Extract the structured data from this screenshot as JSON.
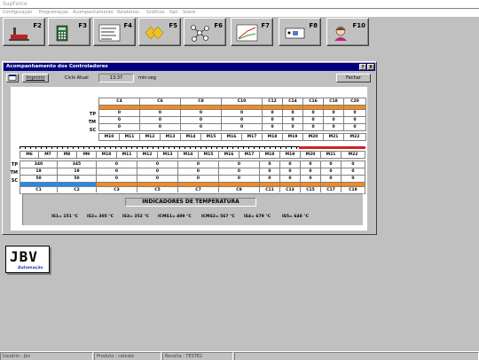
{
  "app": {
    "title": "SupForce"
  },
  "menu": [
    "Configuração",
    "Programação",
    "Acompanhamento",
    "Relatórios",
    "Gráficos",
    "Sair",
    "Sobre"
  ],
  "toolbar": [
    {
      "key": "F2",
      "icon": "furnace-icon"
    },
    {
      "key": "F3",
      "icon": "calculator-icon"
    },
    {
      "key": "F4",
      "icon": "document-list-icon"
    },
    {
      "key": "F5",
      "icon": "diamonds-icon"
    },
    {
      "key": "F6",
      "icon": "network-icon"
    },
    {
      "key": "F7",
      "icon": "trend-chart-icon"
    },
    {
      "key": "F8",
      "icon": "controller-box-icon"
    },
    {
      "key": "F10",
      "icon": "operator-icon"
    }
  ],
  "window": {
    "title": "Acompanhamento dos Controladores",
    "print_label": "Imprimir",
    "cycle_label": "Ciclo Atual",
    "cycle_value": "13:37",
    "cycle_unit": "min:seg",
    "close_label": "Fechar",
    "help_btn": "?",
    "close_btn": "X"
  },
  "top_section": {
    "headers": [
      "C4",
      "C6",
      "C8",
      "C10",
      "C12",
      "C14",
      "C16",
      "C18",
      "C20"
    ],
    "rows": [
      {
        "label": "TP",
        "values": [
          "0",
          "0",
          "0",
          "0",
          "0",
          "0",
          "0",
          "0",
          "0"
        ]
      },
      {
        "label": "TM",
        "values": [
          "0",
          "0",
          "0",
          "0",
          "0",
          "0",
          "0",
          "0",
          "0"
        ]
      },
      {
        "label": "SC",
        "values": [
          "0",
          "0",
          "0",
          "0",
          "0",
          "0",
          "0",
          "0",
          "0"
        ]
      }
    ],
    "motors": [
      "M10",
      "M11",
      "M12",
      "M13",
      "M14",
      "M15",
      "M16",
      "M17",
      "M18",
      "M19",
      "M20",
      "M21",
      "M22"
    ]
  },
  "bottom_section": {
    "motors": [
      "M6",
      "M7",
      "M8",
      "M9",
      "M10",
      "M11",
      "M12",
      "M13",
      "M14",
      "M15",
      "M16",
      "M17",
      "M18",
      "M19",
      "M20",
      "M21",
      "M22"
    ],
    "rows": [
      {
        "label": "TP",
        "values": [
          "340",
          "345",
          "0",
          "0",
          "0",
          "0",
          "0",
          "0",
          "0",
          "0",
          "0"
        ]
      },
      {
        "label": "TM",
        "values": [
          "19",
          "19",
          "0",
          "0",
          "0",
          "0",
          "0",
          "0",
          "0",
          "0",
          "0"
        ]
      },
      {
        "label": "SC",
        "values": [
          "50",
          "50",
          "0",
          "0",
          "0",
          "0",
          "0",
          "0",
          "0",
          "0",
          "0"
        ]
      }
    ],
    "footers": [
      "C1",
      "C2",
      "C3",
      "C5",
      "C7",
      "C9",
      "C11",
      "C13",
      "C15",
      "C17",
      "C19"
    ]
  },
  "indicators": {
    "title": "INDICADORES DE TEMPERATURA",
    "values": [
      "IS1= 151 °C",
      "IS2= 305 °C",
      "IS3= 352 °C",
      "ICMS1= 409 °C",
      "ICMS2= 567 °C",
      "IS4= 679 °C",
      "IS5= 648 °C"
    ]
  },
  "logo": {
    "text": "JBV",
    "subtext": "Automação"
  },
  "status": [
    "Usuário : jbv",
    "Produto : celeste",
    "Receita : TESTE2"
  ],
  "colors": {
    "accent_orange": "#f28a1e",
    "active_blue": "#2288ee",
    "alarm_red": "#d42020",
    "title_navy": "#000080"
  }
}
